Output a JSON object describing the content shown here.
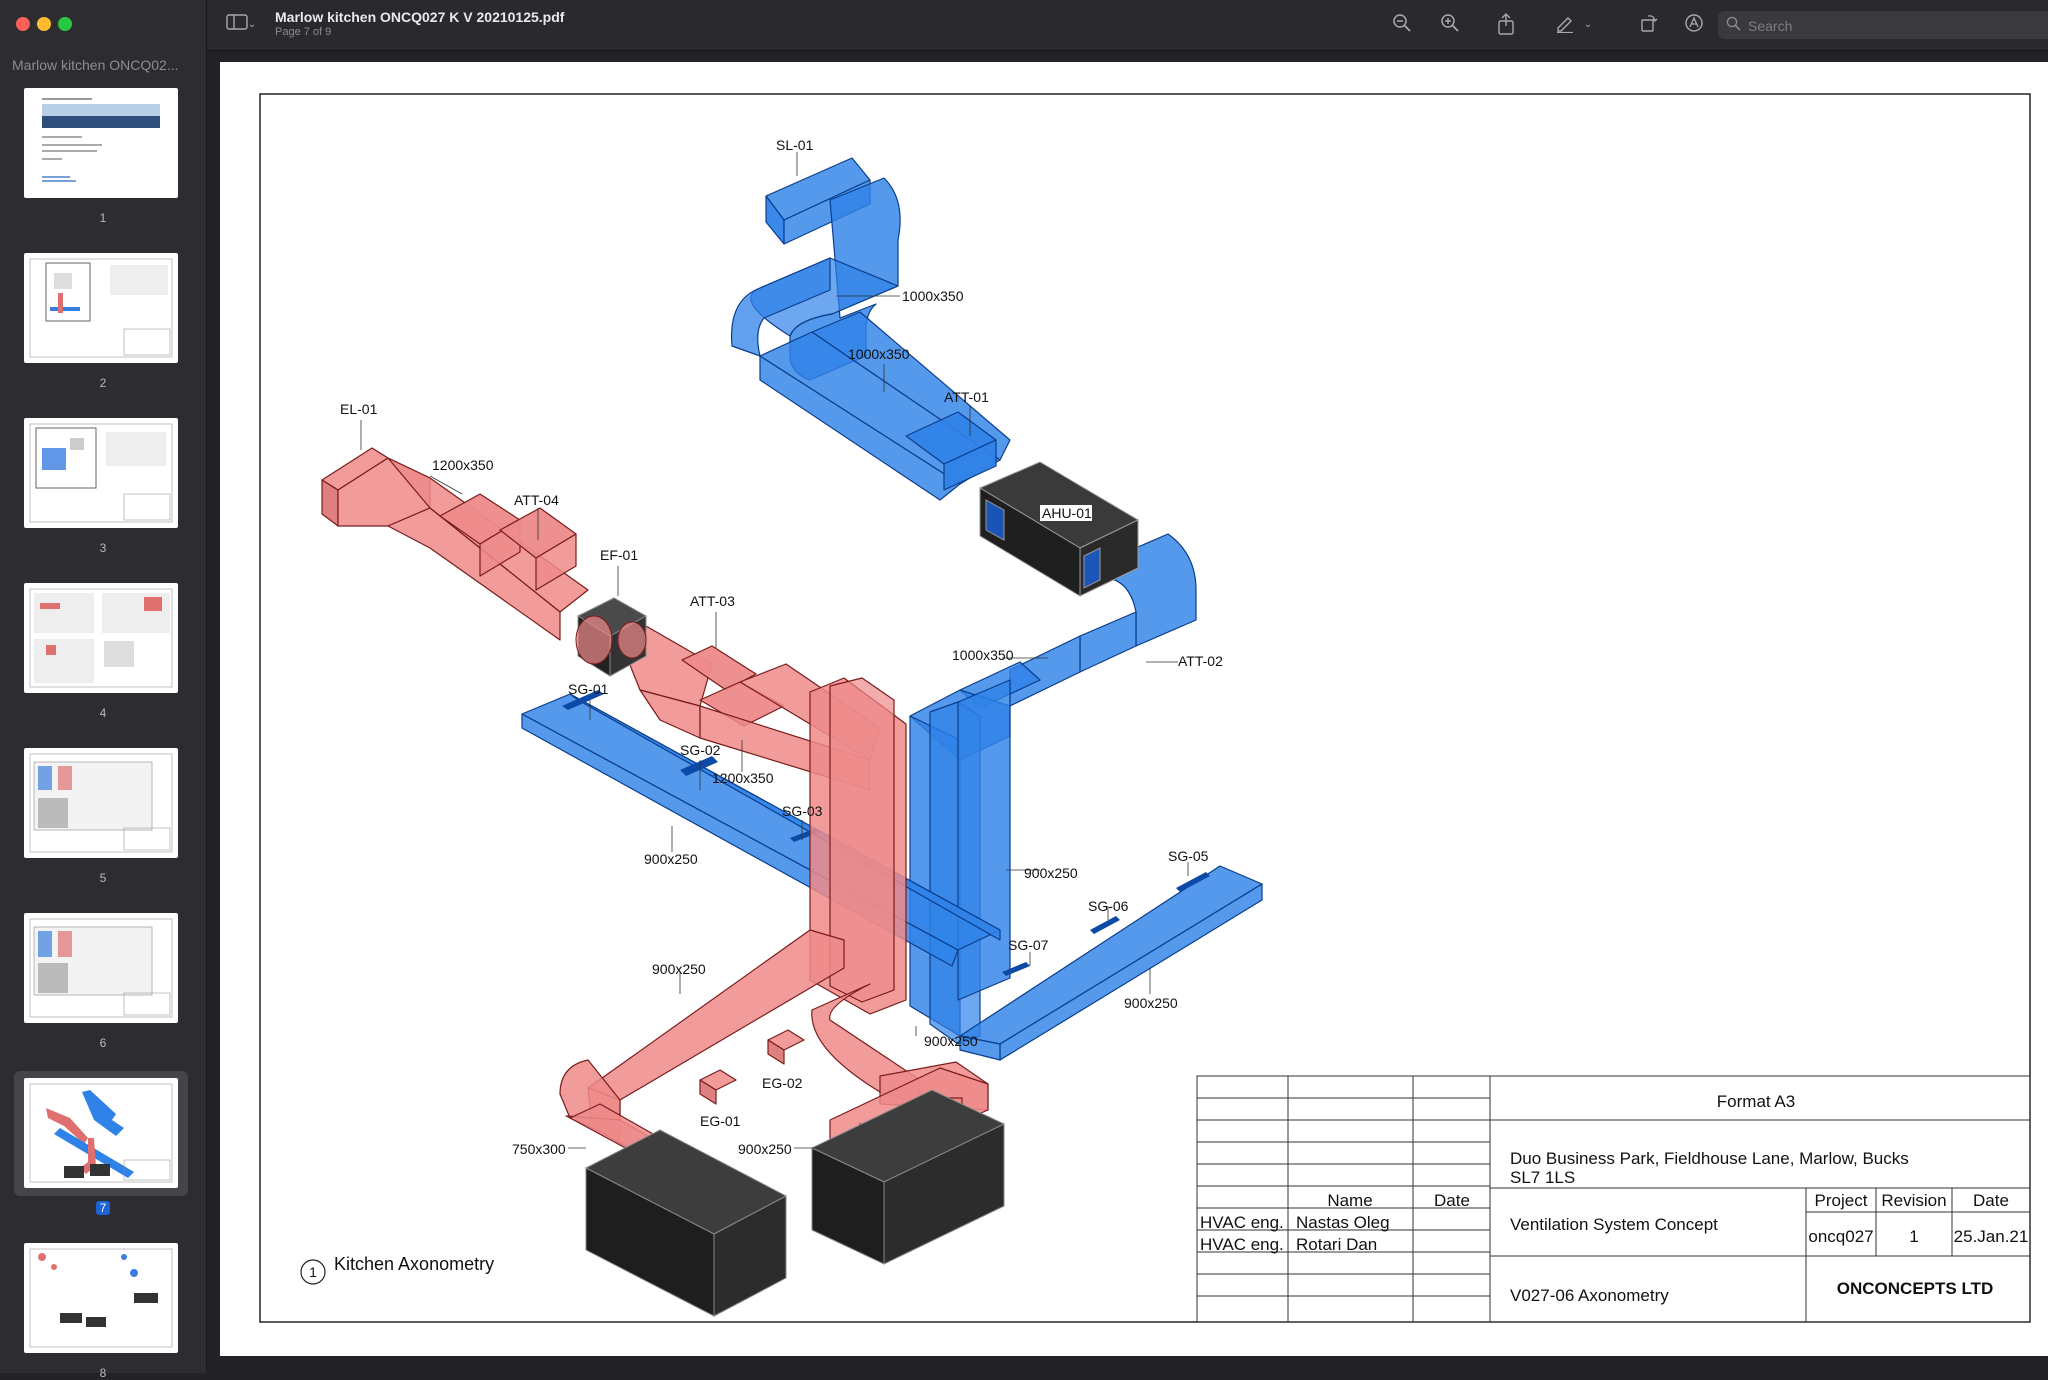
{
  "window": {
    "title": "Marlow kitchen ONCQ027 K V 20210125.pdf",
    "subtitle": "Page 7 of 9"
  },
  "sidebar": {
    "title": "Marlow kitchen ONCQ02...",
    "pages": [
      {
        "num": "1"
      },
      {
        "num": "2"
      },
      {
        "num": "3"
      },
      {
        "num": "4"
      },
      {
        "num": "5"
      },
      {
        "num": "6"
      },
      {
        "num": "7"
      },
      {
        "num": "8"
      }
    ],
    "selected_page": "7"
  },
  "toolbar": {
    "icons": [
      "sidebar-toggle-icon",
      "chevron-down-icon",
      "zoom-out-icon",
      "zoom-in-icon",
      "share-icon",
      "markup-pen-icon",
      "chevron-down-icon",
      "rotate-icon",
      "annotate-icon"
    ],
    "search_placeholder": "Search"
  },
  "drawing": {
    "labels": {
      "sl01": "SL-01",
      "d1000a": "1000x350",
      "d1000b": "1000x350",
      "att01": "ATT-01",
      "ahu01": "AHU-01",
      "d1000c": "1000x350",
      "att02": "ATT-02",
      "el01": "EL-01",
      "d1200a": "1200x350",
      "att04": "ATT-04",
      "ef01": "EF-01",
      "att03": "ATT-03",
      "sg01": "SG-01",
      "sg02": "SG-02",
      "d1200b": "1200x350",
      "sg03": "SG-03",
      "d900a": "900x250",
      "d900b": "900x250",
      "sg05": "SG-05",
      "sg06": "SG-06",
      "sg07": "SG-07",
      "d900c": "900x250",
      "d900d": "900x250",
      "d900e": "900x250",
      "eg02": "EG-02",
      "eg01": "EG-01",
      "d750": "750x300",
      "d900f": "900x250"
    },
    "view_number": "1",
    "view_title": "Kitchen Axonometry",
    "title_block": {
      "format": "Format A3",
      "address_line1": "Duo Business Park, Fieldhouse Lane, Marlow, Bucks",
      "address_line2": "SL7 1LS",
      "col_name": "Name",
      "col_date": "Date",
      "role1": "HVAC eng.",
      "name1": "Nastas Oleg",
      "role2": "HVAC eng.",
      "name2": "Rotari Dan",
      "project_title": "Ventilation System Concept",
      "project_label": "Project",
      "revision_label": "Revision",
      "date_label": "Date",
      "project_value": "oncq027",
      "revision_value": "1",
      "date_value": "25.Jan.21",
      "drawing_name": "V027-06 Axonometry",
      "company": "ONCONCEPTS LTD"
    }
  },
  "colors": {
    "supply": "#2f82e8",
    "extract": "#ee8a8a",
    "unit": "#2b2b2b"
  }
}
